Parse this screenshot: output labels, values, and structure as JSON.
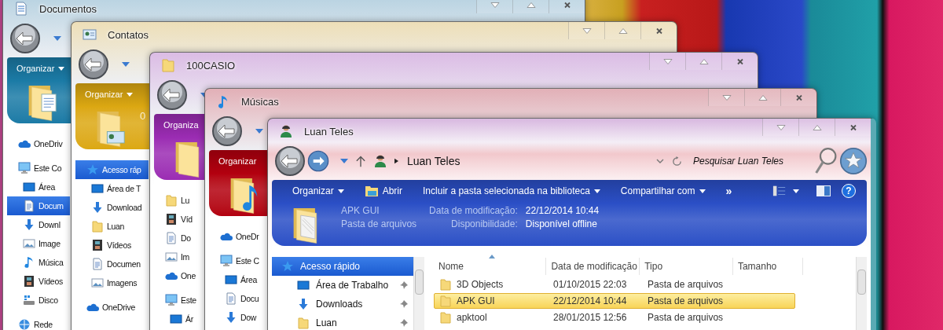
{
  "background_windows": [
    {
      "title": "Documentos",
      "kind": "documents",
      "color": "#1b7ba6",
      "command": "Organizar",
      "menu_caret": true,
      "nav": [
        {
          "label": "OneDriv",
          "kind": "onedrive",
          "selected": false
        },
        {
          "label": "Este Co",
          "kind": "computer",
          "selected": false,
          "children": [
            {
              "label": "Área",
              "kind": "desktop",
              "selected": false
            },
            {
              "label": "Docum",
              "kind": "documents",
              "selected": true
            },
            {
              "label": "Downl",
              "kind": "downloads",
              "selected": false
            },
            {
              "label": "Image",
              "kind": "pictures",
              "selected": false
            },
            {
              "label": "Música",
              "kind": "music",
              "selected": false
            },
            {
              "label": "Vídeos",
              "kind": "videos",
              "selected": false
            },
            {
              "label": "Disco",
              "kind": "disk",
              "selected": false
            }
          ]
        },
        {
          "label": "Rede",
          "kind": "network",
          "selected": false
        }
      ]
    },
    {
      "title": "Contatos",
      "kind": "contacts",
      "color": "#dca812",
      "command": "Organizar",
      "menu_caret": true,
      "detail_fragment": "0",
      "nav": [
        {
          "label": "Acesso ráp",
          "kind": "quick",
          "selected": true,
          "children": [
            {
              "label": "Área de T",
              "kind": "desktop",
              "selected": false
            },
            {
              "label": "Download",
              "kind": "downloads",
              "selected": false
            },
            {
              "label": "Luan",
              "kind": "folder",
              "selected": false
            },
            {
              "label": "Vídeos",
              "kind": "videos",
              "selected": false
            },
            {
              "label": "Documen",
              "kind": "documents",
              "selected": false
            },
            {
              "label": "Imagens",
              "kind": "pictures",
              "selected": false
            }
          ]
        },
        {
          "label": "OneDrive",
          "kind": "onedrive",
          "selected": false
        }
      ]
    },
    {
      "title": "100CASIO",
      "kind": "pictures",
      "color": "#9b2cb3",
      "command": "Organiza",
      "menu_caret": false,
      "nav": [
        {
          "label": "Lu",
          "kind": "folder",
          "selected": false
        },
        {
          "label": "Víd",
          "kind": "videos",
          "selected": false
        },
        {
          "label": "Do",
          "kind": "documents",
          "selected": false
        },
        {
          "label": "Im",
          "kind": "pictures",
          "selected": false
        },
        {
          "label": "One",
          "kind": "onedrive",
          "selected": false
        },
        {
          "label": "Este",
          "kind": "computer",
          "selected": false,
          "children": [
            {
              "label": "Ár",
              "kind": "desktop",
              "selected": false
            }
          ]
        }
      ]
    },
    {
      "title": "Músicas",
      "kind": "music",
      "color": "#b3000f",
      "command": "Organizar",
      "menu_caret": false,
      "nav": [
        {
          "label": "OneDr",
          "kind": "onedrive",
          "selected": false
        },
        {
          "label": "Este C",
          "kind": "computer",
          "selected": false,
          "children": [
            {
              "label": "Área",
              "kind": "desktop",
              "selected": false
            },
            {
              "label": "Docu",
              "kind": "documents",
              "selected": false
            },
            {
              "label": "Dow",
              "kind": "downloads",
              "selected": false
            }
          ]
        }
      ]
    }
  ],
  "window": {
    "title": "Luan Teles",
    "kind": "user",
    "color": "#2b4fc6",
    "address": "Luan Teles",
    "help": "?",
    "search": {
      "placeholder": "Pesquisar Luan Teles"
    },
    "commands": [
      {
        "label": "Organizar",
        "kind": "menu"
      },
      {
        "label": "Abrir",
        "kind": "open"
      },
      {
        "label": "Incluir a pasta selecionada na biblioteca",
        "kind": "menu"
      },
      {
        "label": "Compartilhar com",
        "kind": "menu"
      },
      {
        "label": "»",
        "kind": "more"
      }
    ],
    "details": {
      "name": "APK GUI",
      "type": "Pasta de arquivos",
      "fields": [
        {
          "label": "Data de modificação:",
          "value": "22/12/2014 10:44"
        },
        {
          "label": "Disponibilidade:",
          "value": "Disponível offline"
        }
      ]
    },
    "nav": [
      {
        "label": "Acesso rápido",
        "kind": "quick",
        "selected": true,
        "children": [
          {
            "label": "Área de Trabalho",
            "kind": "desktop",
            "selected": false,
            "pinned": true
          },
          {
            "label": "Downloads",
            "kind": "downloads",
            "selected": false,
            "pinned": true
          },
          {
            "label": "Luan",
            "kind": "folder",
            "selected": false,
            "pinned": true
          }
        ]
      }
    ],
    "columns": [
      {
        "label": "Nome",
        "sorted": true
      },
      {
        "label": "Data de modificação",
        "sorted": false
      },
      {
        "label": "Tipo",
        "sorted": false
      },
      {
        "label": "Tamanho",
        "sorted": false
      }
    ],
    "rows": [
      {
        "name": "3D Objects",
        "modified": "01/10/2015 22:03",
        "type": "Pasta de arquivos",
        "selected": false
      },
      {
        "name": "APK GUI",
        "modified": "22/12/2014 10:44",
        "type": "Pasta de arquivos",
        "selected": true
      },
      {
        "name": "apktool",
        "modified": "28/01/2015 12:56",
        "type": "Pasta de arquivos",
        "selected": false
      }
    ]
  }
}
